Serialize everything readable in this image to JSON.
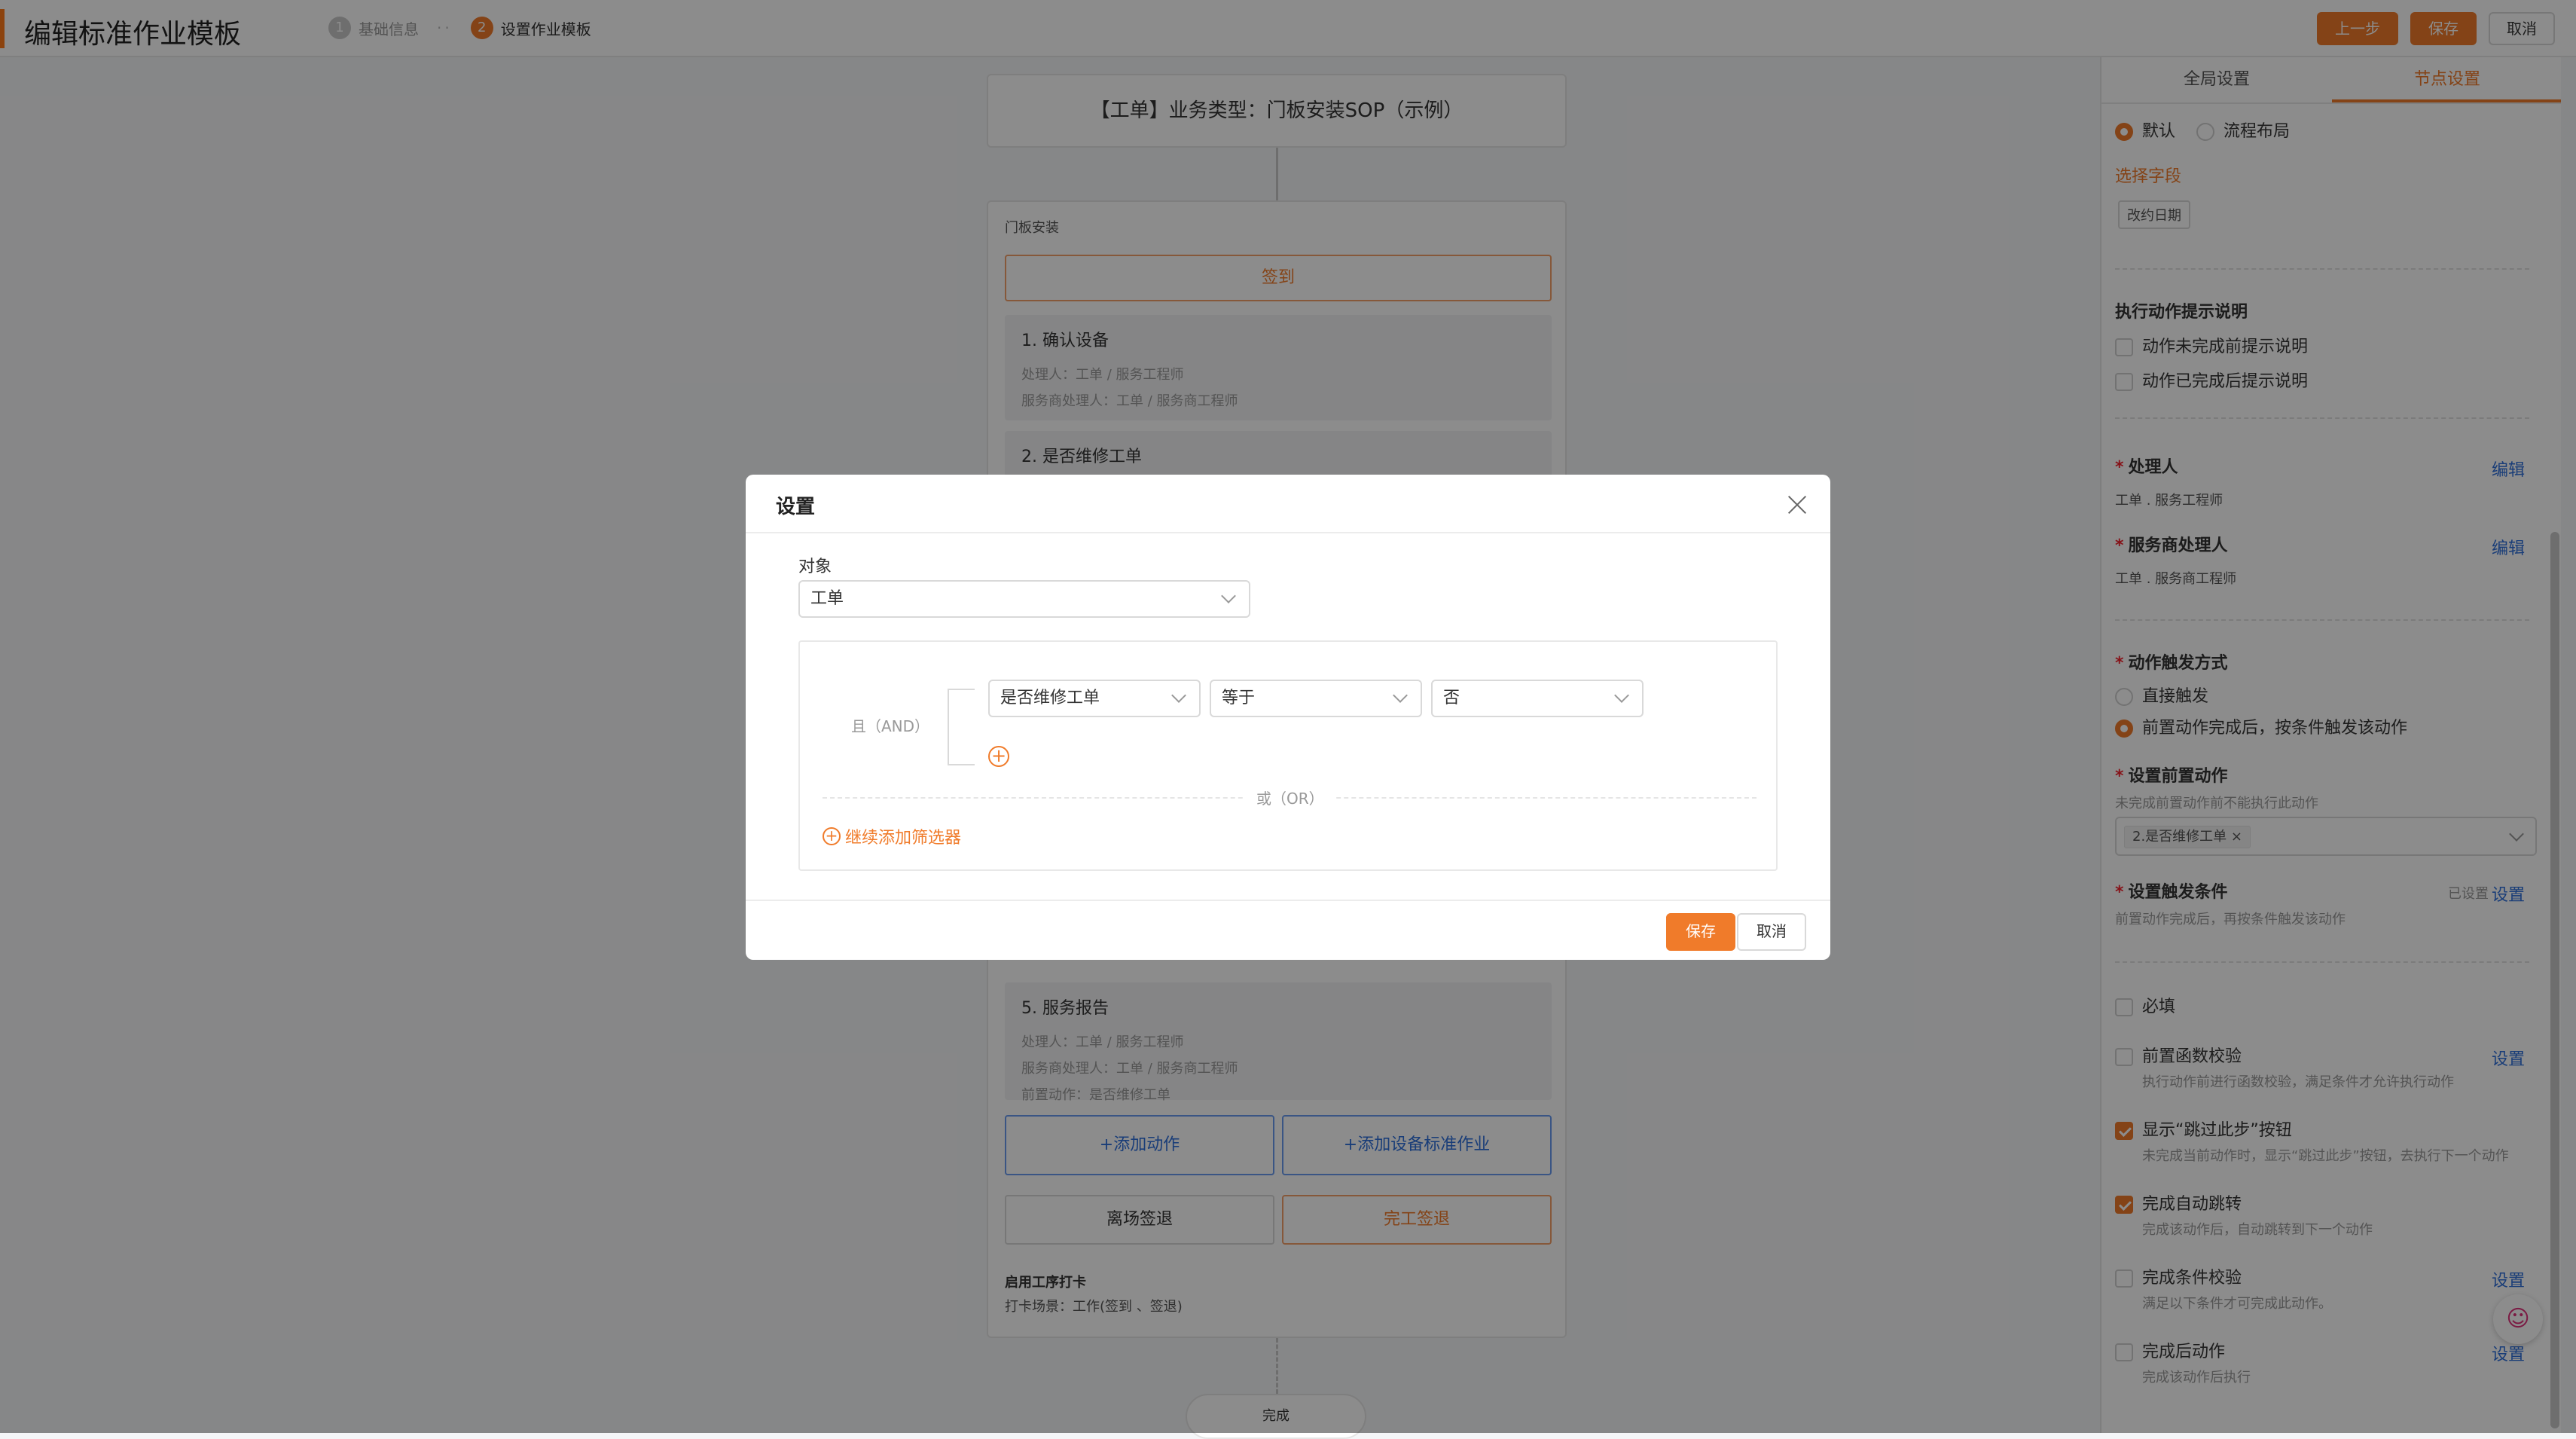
{
  "header": {
    "title": "编辑标准作业模板",
    "steps": [
      {
        "num": "1",
        "label": "基础信息"
      },
      {
        "num": "2",
        "label": "设置作业模板"
      }
    ],
    "dots": "··",
    "buttons": {
      "prev": "上一步",
      "save": "保存",
      "cancel": "取消"
    }
  },
  "flow": {
    "top_card": "【工单】业务类型：门板安装SOP（示例）",
    "node_title": "门板安装",
    "signin": "签到",
    "actions": [
      {
        "title": "1. 确认设备",
        "meta": [
          "处理人：工单 / 服务工程师",
          "服务商处理人：工单 / 服务商工程师"
        ]
      },
      {
        "title": "2. 是否维修工单",
        "meta": []
      },
      {
        "title": "5. 服务报告",
        "meta": [
          "处理人：工单 / 服务工程师",
          "服务商处理人：工单 / 服务商工程师",
          "前置动作：是否维修工单"
        ]
      }
    ],
    "add_action": "+添加动作",
    "add_device_sop": "+添加设备标准作业",
    "leave_sign": "离场签退",
    "finish_sign": "完工签退",
    "clock_title": "启用工序打卡",
    "clock_desc": "打卡场景：工作(签到 、签退)",
    "finish": "完成"
  },
  "panel": {
    "tabs": [
      "全局设置",
      "节点设置"
    ],
    "layout_options": [
      "默认",
      "流程布局"
    ],
    "select_field_label": "选择字段",
    "field_tag": "改约日期",
    "hint_title": "执行动作提示说明",
    "hint_before": "动作未完成前提示说明",
    "hint_after": "动作已完成后提示说明",
    "handler_label": "处理人",
    "handler_value": "工单 . 服务工程师",
    "sp_handler_label": "服务商处理人",
    "sp_handler_value": "工单 . 服务商工程师",
    "edit": "编辑",
    "trigger_label": "动作触发方式",
    "trigger_direct": "直接触发",
    "trigger_after": "前置动作完成后，按条件触发该动作",
    "pre_action_label": "设置前置动作",
    "pre_action_hint": "未完成前置动作前不能执行此动作",
    "pre_action_tag": "2.是否维修工单",
    "trigger_cond_label": "设置触发条件",
    "trigger_cond_hint": "前置动作完成后，再按条件触发该动作",
    "already_set": "已设置",
    "set": "设置",
    "required": "必填",
    "pre_func_check": "前置函数校验",
    "pre_func_hint": "执行动作前进行函数校验，满足条件才允许执行动作",
    "show_skip": "显示“跳过此步”按钮",
    "show_skip_hint": "未完成当前动作时，显示“跳过此步”按钮，去执行下一个动作",
    "auto_jump": "完成自动跳转",
    "auto_jump_hint": "完成该动作后，自动跳转到下一个动作",
    "finish_check": "完成条件校验",
    "finish_check_hint": "满足以下条件才可完成此动作。",
    "after_action": "完成后动作",
    "after_action_hint": "完成该动作后执行"
  },
  "modal": {
    "title": "设置",
    "object_label": "对象",
    "object_value": "工单",
    "and_label": "且（AND）",
    "field": "是否维修工单",
    "operator": "等于",
    "value": "否",
    "or_label": "或（OR）",
    "add_filter": "继续添加筛选器",
    "save": "保存",
    "cancel": "取消"
  },
  "colors": {
    "accent": "#f07b2a",
    "link": "#2f6fdb"
  }
}
